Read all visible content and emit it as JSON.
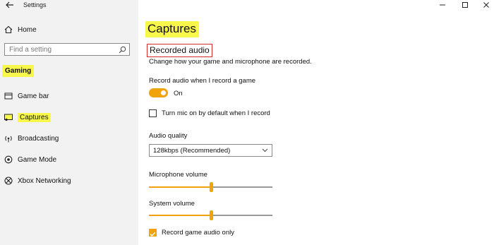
{
  "window": {
    "title": "Settings"
  },
  "sidebar": {
    "home_label": "Home",
    "search_placeholder": "Find a setting",
    "section_heading": "Gaming",
    "items": [
      {
        "label": "Game bar",
        "icon": "game-bar-icon"
      },
      {
        "label": "Captures",
        "icon": "captures-icon",
        "selected": true
      },
      {
        "label": "Broadcasting",
        "icon": "broadcasting-icon"
      },
      {
        "label": "Game Mode",
        "icon": "game-mode-icon"
      },
      {
        "label": "Xbox Networking",
        "icon": "xbox-icon"
      }
    ]
  },
  "main": {
    "title": "Captures",
    "section_title": "Recorded audio",
    "description": "Change how your game and microphone are recorded.",
    "record_audio": {
      "label": "Record audio when I record a game",
      "state_text": "On",
      "on": true
    },
    "mic_default": {
      "label": "Turn mic on by default when I record",
      "checked": false
    },
    "audio_quality": {
      "label": "Audio quality",
      "value": "128kbps (Recommended)"
    },
    "microphone_volume": {
      "label": "Microphone volume",
      "percent": 50
    },
    "system_volume": {
      "label": "System volume",
      "percent": 50
    },
    "game_audio_only": {
      "label": "Record game audio only",
      "checked": true
    }
  },
  "colors": {
    "accent": "#f0a30a",
    "highlight": "#f7f84b",
    "annotation": "#d62b2b"
  }
}
